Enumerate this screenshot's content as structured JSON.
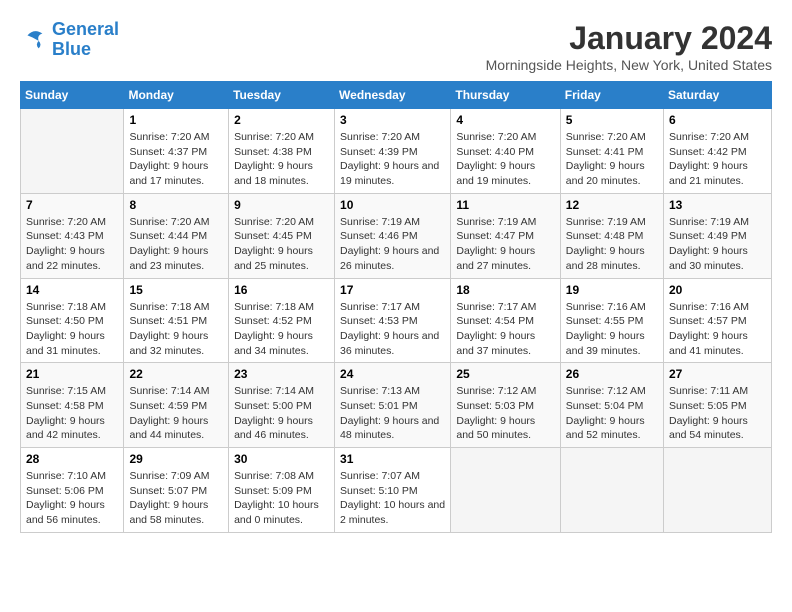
{
  "logo": {
    "line1": "General",
    "line2": "Blue"
  },
  "title": "January 2024",
  "location": "Morningside Heights, New York, United States",
  "days_of_week": [
    "Sunday",
    "Monday",
    "Tuesday",
    "Wednesday",
    "Thursday",
    "Friday",
    "Saturday"
  ],
  "weeks": [
    [
      {
        "day": null
      },
      {
        "day": 1,
        "sunrise": "7:20 AM",
        "sunset": "4:37 PM",
        "daylight": "9 hours and 17 minutes."
      },
      {
        "day": 2,
        "sunrise": "7:20 AM",
        "sunset": "4:38 PM",
        "daylight": "9 hours and 18 minutes."
      },
      {
        "day": 3,
        "sunrise": "7:20 AM",
        "sunset": "4:39 PM",
        "daylight": "9 hours and 19 minutes."
      },
      {
        "day": 4,
        "sunrise": "7:20 AM",
        "sunset": "4:40 PM",
        "daylight": "9 hours and 19 minutes."
      },
      {
        "day": 5,
        "sunrise": "7:20 AM",
        "sunset": "4:41 PM",
        "daylight": "9 hours and 20 minutes."
      },
      {
        "day": 6,
        "sunrise": "7:20 AM",
        "sunset": "4:42 PM",
        "daylight": "9 hours and 21 minutes."
      }
    ],
    [
      {
        "day": 7,
        "sunrise": "7:20 AM",
        "sunset": "4:43 PM",
        "daylight": "9 hours and 22 minutes."
      },
      {
        "day": 8,
        "sunrise": "7:20 AM",
        "sunset": "4:44 PM",
        "daylight": "9 hours and 23 minutes."
      },
      {
        "day": 9,
        "sunrise": "7:20 AM",
        "sunset": "4:45 PM",
        "daylight": "9 hours and 25 minutes."
      },
      {
        "day": 10,
        "sunrise": "7:19 AM",
        "sunset": "4:46 PM",
        "daylight": "9 hours and 26 minutes."
      },
      {
        "day": 11,
        "sunrise": "7:19 AM",
        "sunset": "4:47 PM",
        "daylight": "9 hours and 27 minutes."
      },
      {
        "day": 12,
        "sunrise": "7:19 AM",
        "sunset": "4:48 PM",
        "daylight": "9 hours and 28 minutes."
      },
      {
        "day": 13,
        "sunrise": "7:19 AM",
        "sunset": "4:49 PM",
        "daylight": "9 hours and 30 minutes."
      }
    ],
    [
      {
        "day": 14,
        "sunrise": "7:18 AM",
        "sunset": "4:50 PM",
        "daylight": "9 hours and 31 minutes."
      },
      {
        "day": 15,
        "sunrise": "7:18 AM",
        "sunset": "4:51 PM",
        "daylight": "9 hours and 32 minutes."
      },
      {
        "day": 16,
        "sunrise": "7:18 AM",
        "sunset": "4:52 PM",
        "daylight": "9 hours and 34 minutes."
      },
      {
        "day": 17,
        "sunrise": "7:17 AM",
        "sunset": "4:53 PM",
        "daylight": "9 hours and 36 minutes."
      },
      {
        "day": 18,
        "sunrise": "7:17 AM",
        "sunset": "4:54 PM",
        "daylight": "9 hours and 37 minutes."
      },
      {
        "day": 19,
        "sunrise": "7:16 AM",
        "sunset": "4:55 PM",
        "daylight": "9 hours and 39 minutes."
      },
      {
        "day": 20,
        "sunrise": "7:16 AM",
        "sunset": "4:57 PM",
        "daylight": "9 hours and 41 minutes."
      }
    ],
    [
      {
        "day": 21,
        "sunrise": "7:15 AM",
        "sunset": "4:58 PM",
        "daylight": "9 hours and 42 minutes."
      },
      {
        "day": 22,
        "sunrise": "7:14 AM",
        "sunset": "4:59 PM",
        "daylight": "9 hours and 44 minutes."
      },
      {
        "day": 23,
        "sunrise": "7:14 AM",
        "sunset": "5:00 PM",
        "daylight": "9 hours and 46 minutes."
      },
      {
        "day": 24,
        "sunrise": "7:13 AM",
        "sunset": "5:01 PM",
        "daylight": "9 hours and 48 minutes."
      },
      {
        "day": 25,
        "sunrise": "7:12 AM",
        "sunset": "5:03 PM",
        "daylight": "9 hours and 50 minutes."
      },
      {
        "day": 26,
        "sunrise": "7:12 AM",
        "sunset": "5:04 PM",
        "daylight": "9 hours and 52 minutes."
      },
      {
        "day": 27,
        "sunrise": "7:11 AM",
        "sunset": "5:05 PM",
        "daylight": "9 hours and 54 minutes."
      }
    ],
    [
      {
        "day": 28,
        "sunrise": "7:10 AM",
        "sunset": "5:06 PM",
        "daylight": "9 hours and 56 minutes."
      },
      {
        "day": 29,
        "sunrise": "7:09 AM",
        "sunset": "5:07 PM",
        "daylight": "9 hours and 58 minutes."
      },
      {
        "day": 30,
        "sunrise": "7:08 AM",
        "sunset": "5:09 PM",
        "daylight": "10 hours and 0 minutes."
      },
      {
        "day": 31,
        "sunrise": "7:07 AM",
        "sunset": "5:10 PM",
        "daylight": "10 hours and 2 minutes."
      },
      {
        "day": null
      },
      {
        "day": null
      },
      {
        "day": null
      }
    ]
  ]
}
